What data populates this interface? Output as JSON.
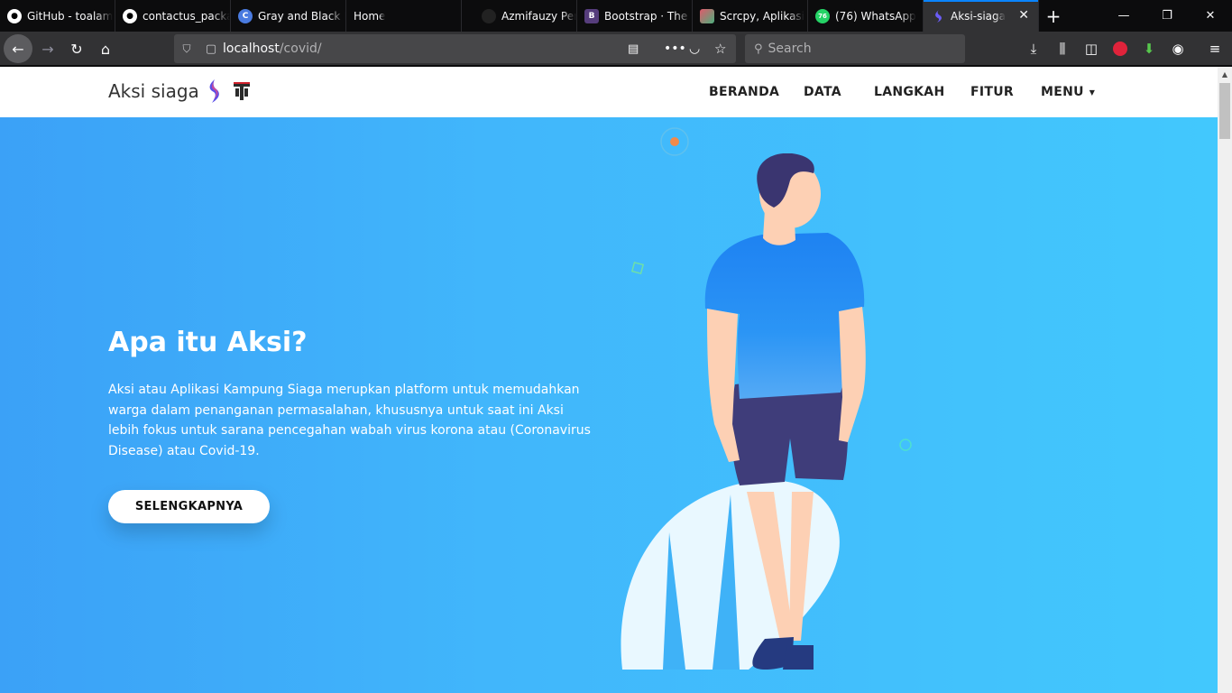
{
  "browser": {
    "tabs": [
      {
        "title": "GitHub - toalam",
        "icon": "github-icon",
        "color": "#ffffff"
      },
      {
        "title": "contactus_packa",
        "icon": "github-icon",
        "color": "#ffffff"
      },
      {
        "title": "Gray and Black F",
        "icon": "c-icon",
        "color": "#4a7be0"
      },
      {
        "title": "Home",
        "icon": "blank-icon",
        "color": "#0c0c0d"
      },
      {
        "title": "Azmifauzy Perso",
        "icon": "avatar-icon",
        "color": "#111111"
      },
      {
        "title": "Bootstrap · The m",
        "icon": "bootstrap-icon",
        "color": "#563d7c"
      },
      {
        "title": "Scrcpy, Aplikasi",
        "icon": "scrcpy-icon",
        "color": "#e05a6b"
      },
      {
        "title": "(76) WhatsApp",
        "icon": "whatsapp-icon",
        "color": "#25d366",
        "badge": "76"
      },
      {
        "title": "Aksi-siaga",
        "icon": "aksi-icon",
        "color": "#6a5cf5",
        "active": true
      }
    ],
    "url_host": "localhost",
    "url_path": "/covid/",
    "search_placeholder": "Search"
  },
  "site": {
    "brand": "Aksi siaga",
    "nav": [
      "BERANDA",
      "DATA",
      "LANGKAH",
      "FITUR",
      "MENU"
    ],
    "hero": {
      "title": "Apa itu Aksi?",
      "text": "Aksi atau Aplikasi Kampung Siaga merupkan platform untuk memudahkan warga dalam penanganan permasalahan, khususnya untuk saat ini Aksi lebih fokus untuk sarana pencegahan wabah virus korona atau (Coronavirus Disease) atau Covid-19.",
      "button": "SELENGKAPNYA"
    }
  },
  "colors": {
    "accent": "#0a84ff",
    "hero_start": "#3ba1f7",
    "hero_end": "#42c8fd",
    "shirt": "#1e88f5",
    "shorts": "#3f3d7a",
    "skin": "#fdd0b4"
  }
}
